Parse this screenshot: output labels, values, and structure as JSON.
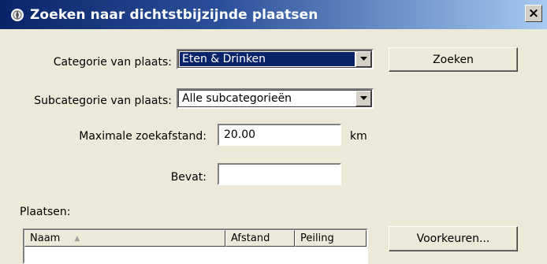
{
  "window": {
    "title": "Zoeken naar dichtstbijzijnde plaatsen",
    "icon": "compass-icon",
    "close_label": "×"
  },
  "form": {
    "category_label": "Categorie van plaats:",
    "category_value": "Eten & Drinken",
    "subcategory_label": "Subcategorie van plaats:",
    "subcategory_value": "Alle subcategorieën",
    "max_distance_label": "Maximale zoekafstand:",
    "max_distance_value": "20.00",
    "distance_unit": "km",
    "contains_label": "Bevat:",
    "contains_value": ""
  },
  "buttons": {
    "search": "Zoeken",
    "preferences": "Voorkeuren..."
  },
  "places": {
    "label": "Plaatsen:",
    "columns": [
      "Naam",
      "Afstand",
      "Peiling"
    ],
    "sort_indicator": "▲"
  },
  "colors": {
    "titlebar_start": "#0a246a",
    "titlebar_end": "#a6caf0",
    "selection": "#0a246a",
    "dialog_bg": "#ece9d8"
  }
}
